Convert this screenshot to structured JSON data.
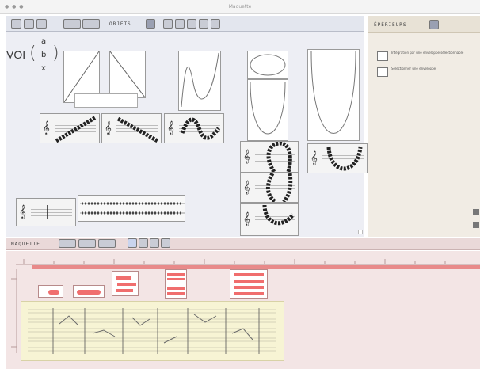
{
  "window": {
    "title": "Maquette",
    "controls": "● ● ●"
  },
  "objects_toolbar": {
    "section_label": "OBJETS"
  },
  "side_panel": {
    "title": "ÉPÉRIEURS",
    "items": [
      {
        "label": "Intégration par une enveloppe sélectionnable"
      },
      {
        "label": "Sélectionner une enveloppe"
      }
    ]
  },
  "objects": {
    "voir_label": "VOI",
    "matrix": [
      "a",
      "b",
      "x"
    ]
  },
  "maquette_toolbar": {
    "section_label": "MAQUETTE"
  },
  "colors": {
    "accent": "#f06e6e",
    "objects_bg": "#edeef4",
    "side_bg": "#f1ece4",
    "maquette_bg": "#f3e5e5"
  }
}
